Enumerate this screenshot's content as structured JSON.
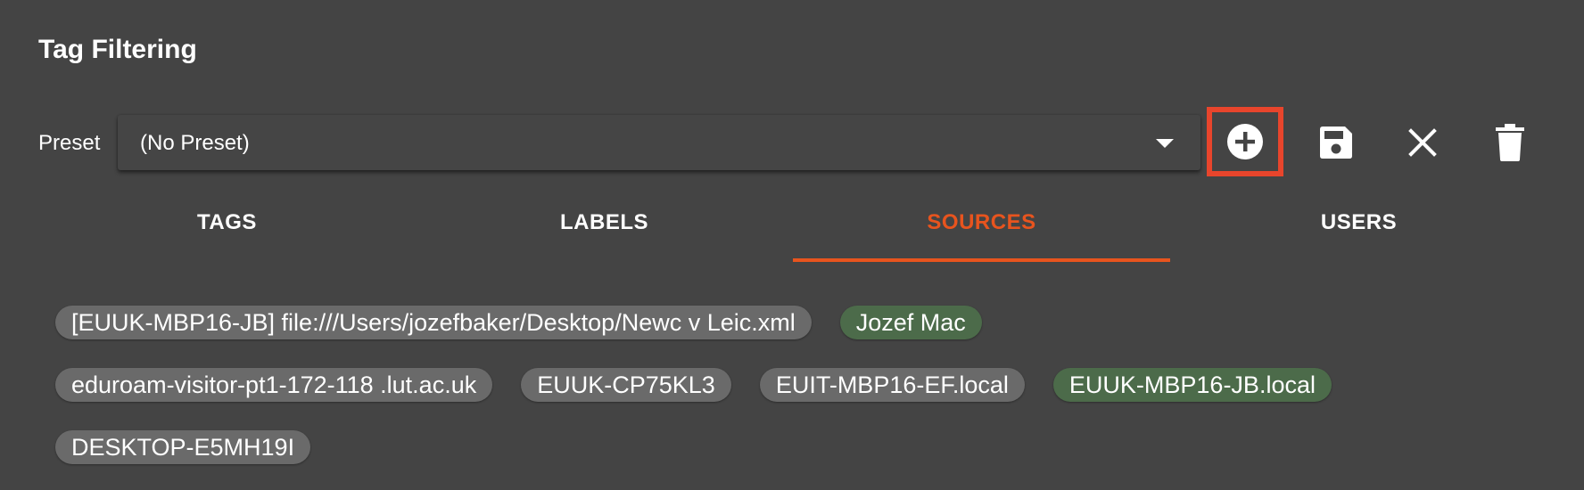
{
  "header": {
    "title": "Tag Filtering"
  },
  "preset": {
    "label": "Preset",
    "value": "(No Preset)",
    "dropdown_icon": "caret-down-icon"
  },
  "toolbar": {
    "add_icon": "add-circle-icon",
    "save_icon": "floppy-disk-icon",
    "clear_icon": "close-icon",
    "delete_icon": "trash-icon",
    "highlight_color": "#e8452c"
  },
  "tabs": [
    {
      "label": "TAGS",
      "active": false
    },
    {
      "label": "LABELS",
      "active": false
    },
    {
      "label": "SOURCES",
      "active": true
    },
    {
      "label": "USERS",
      "active": false
    }
  ],
  "colors": {
    "background": "#444444",
    "accent": "#e8541e",
    "chip_default": "#6a6a6a",
    "chip_selected": "#4c6b4a"
  },
  "sources": [
    {
      "label": "[EUUK-MBP16-JB] file:///Users/jozefbaker/Desktop/Newc v Leic.xml",
      "selected": false
    },
    {
      "label": "Jozef Mac",
      "selected": true
    },
    {
      "label": "eduroam-visitor-pt1-172-118 .lut.ac.uk",
      "selected": false
    },
    {
      "label": "EUUK-CP75KL3",
      "selected": false
    },
    {
      "label": "EUIT-MBP16-EF.local",
      "selected": false
    },
    {
      "label": "EUUK-MBP16-JB.local",
      "selected": true
    },
    {
      "label": "DESKTOP-E5MH19I",
      "selected": false
    }
  ]
}
